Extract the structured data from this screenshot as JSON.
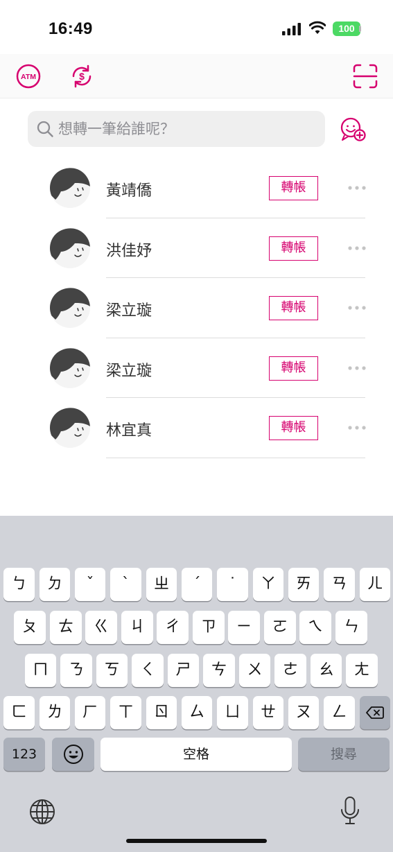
{
  "status_bar": {
    "time": "16:49",
    "battery": "100"
  },
  "top_bar": {
    "icons": [
      "atm-icon",
      "currency-exchange-icon",
      "scan-icon"
    ],
    "accent_color": "#d6006e"
  },
  "search": {
    "placeholder": "想轉一筆給誰呢？"
  },
  "contacts": [
    {
      "name": "黃靖僑",
      "action": "轉帳"
    },
    {
      "name": "洪佳妤",
      "action": "轉帳"
    },
    {
      "name": "梁立璇",
      "action": "轉帳"
    },
    {
      "name": "梁立璇",
      "action": "轉帳"
    },
    {
      "name": "林宜真",
      "action": "轉帳"
    }
  ],
  "keyboard": {
    "row1": [
      "ㄅ",
      "ㄉ",
      "ˇ",
      "ˋ",
      "ㄓ",
      "ˊ",
      "˙",
      "ㄚ",
      "ㄞ",
      "ㄢ",
      "ㄦ"
    ],
    "row2": [
      "ㄆ",
      "ㄊ",
      "ㄍ",
      "ㄐ",
      "ㄔ",
      "ㄗ",
      "ㄧ",
      "ㄛ",
      "ㄟ",
      "ㄣ"
    ],
    "row3": [
      "ㄇ",
      "ㄋ",
      "ㄎ",
      "ㄑ",
      "ㄕ",
      "ㄘ",
      "ㄨ",
      "ㄜ",
      "ㄠ",
      "ㄤ"
    ],
    "row4": [
      "ㄈ",
      "ㄌ",
      "ㄏ",
      "ㄒ",
      "ㄖ",
      "ㄙ",
      "ㄩ",
      "ㄝ",
      "ㄡ",
      "ㄥ"
    ],
    "numbers_label": "123",
    "space_label": "空格",
    "search_label": "搜尋"
  }
}
